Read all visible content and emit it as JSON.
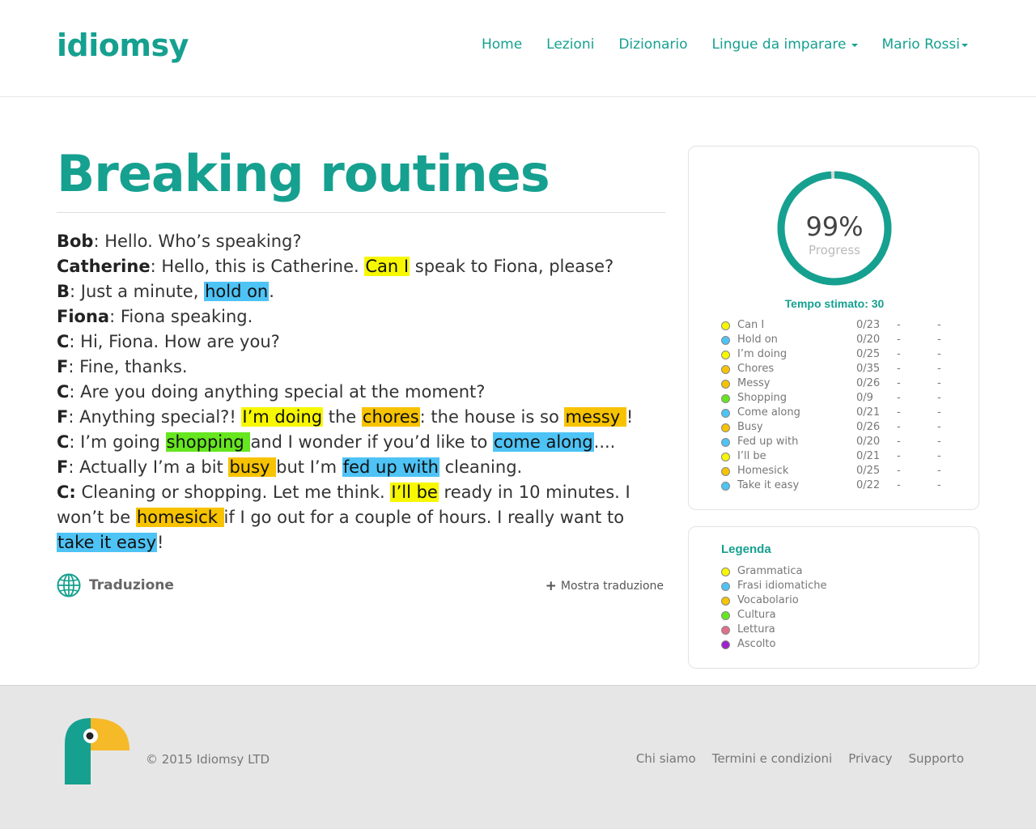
{
  "brand": {
    "logo_text": "idiomsy",
    "accent_color": "#16a090"
  },
  "nav": {
    "home": "Home",
    "lezioni": "Lezioni",
    "dizionario": "Dizionario",
    "lingue": "Lingue da imparare",
    "user": "Mario Rossi"
  },
  "lesson": {
    "title": "Breaking routines",
    "lines": [
      {
        "speaker": "Bob",
        "parts": [
          {
            "t": ": Hello. Who’s speaking?"
          }
        ]
      },
      {
        "speaker": "Catherine",
        "parts": [
          {
            "t": ": Hello, this is Catherine. "
          },
          {
            "t": "Can I",
            "hl": "yellow"
          },
          {
            "t": " speak to Fiona, please?"
          }
        ]
      },
      {
        "speaker": "B",
        "parts": [
          {
            "t": ": Just a minute, "
          },
          {
            "t": "hold on",
            "hl": "blue"
          },
          {
            "t": "."
          }
        ]
      },
      {
        "speaker": "Fiona",
        "parts": [
          {
            "t": ": Fiona speaking."
          }
        ]
      },
      {
        "speaker": "C",
        "parts": [
          {
            "t": ": Hi, Fiona. How are you?"
          }
        ]
      },
      {
        "speaker": "F",
        "parts": [
          {
            "t": ": Fine, thanks."
          }
        ]
      },
      {
        "speaker": "C",
        "parts": [
          {
            "t": ": Are you doing anything special at the moment?"
          }
        ]
      },
      {
        "speaker": "F",
        "parts": [
          {
            "t": ": Anything special?! "
          },
          {
            "t": "I’m doing",
            "hl": "yellow"
          },
          {
            "t": " the "
          },
          {
            "t": "chores",
            "hl": "orange"
          },
          {
            "t": ": the house is so "
          },
          {
            "t": "messy ",
            "hl": "orange"
          },
          {
            "t": "!"
          }
        ]
      },
      {
        "speaker": "C",
        "parts": [
          {
            "t": ": I’m going "
          },
          {
            "t": "shopping ",
            "hl": "green"
          },
          {
            "t": "and I wonder if you’d like to "
          },
          {
            "t": "come along",
            "hl": "blue"
          },
          {
            "t": "...."
          }
        ]
      },
      {
        "speaker": "F",
        "parts": [
          {
            "t": ": Actually I’m a bit "
          },
          {
            "t": "busy ",
            "hl": "orange"
          },
          {
            "t": "but I’m "
          },
          {
            "t": "fed up with",
            "hl": "blue"
          },
          {
            "t": " cleaning."
          }
        ]
      },
      {
        "speaker": "C:",
        "parts": [
          {
            "t": " Cleaning or shopping. Let me think. "
          },
          {
            "t": "I’ll be",
            "hl": "yellow"
          },
          {
            "t": " ready in 10 minutes. I won’t be "
          },
          {
            "t": "homesick ",
            "hl": "orange"
          },
          {
            "t": "if I go out for a couple of hours. I really want to "
          },
          {
            "t": "take it easy",
            "hl": "blue"
          },
          {
            "t": "!"
          }
        ]
      }
    ],
    "translation_label": "Traduzione",
    "show_translation": "Mostra traduzione"
  },
  "progress": {
    "percent_text": "99%",
    "percent_value": 0.99,
    "label": "Progress",
    "tempo": "Tempo stimato: 30",
    "items": [
      {
        "name": "Can I",
        "score": "0/23",
        "d1": "-",
        "d2": "-",
        "color": "#f7f700"
      },
      {
        "name": "Hold on",
        "score": "0/20",
        "d1": "-",
        "d2": "-",
        "color": "#4ec3f5"
      },
      {
        "name": "I’m doing",
        "score": "0/25",
        "d1": "-",
        "d2": "-",
        "color": "#f7f700"
      },
      {
        "name": "Chores",
        "score": "0/35",
        "d1": "-",
        "d2": "-",
        "color": "#f7c300"
      },
      {
        "name": "Messy",
        "score": "0/26",
        "d1": "-",
        "d2": "-",
        "color": "#f7c300"
      },
      {
        "name": "Shopping",
        "score": "0/9",
        "d1": "-",
        "d2": "-",
        "color": "#66e61f"
      },
      {
        "name": "Come along",
        "score": "0/21",
        "d1": "-",
        "d2": "-",
        "color": "#4ec3f5"
      },
      {
        "name": "Busy",
        "score": "0/26",
        "d1": "-",
        "d2": "-",
        "color": "#f7c300"
      },
      {
        "name": "Fed up with",
        "score": "0/20",
        "d1": "-",
        "d2": "-",
        "color": "#4ec3f5"
      },
      {
        "name": "I’ll be",
        "score": "0/21",
        "d1": "-",
        "d2": "-",
        "color": "#f7f700"
      },
      {
        "name": "Homesick",
        "score": "0/25",
        "d1": "-",
        "d2": "-",
        "color": "#f7c300"
      },
      {
        "name": "Take it easy",
        "score": "0/22",
        "d1": "-",
        "d2": "-",
        "color": "#4ec3f5"
      }
    ]
  },
  "legend": {
    "title": "Legenda",
    "items": [
      {
        "name": "Grammatica",
        "color": "#f7f700"
      },
      {
        "name": "Frasi idiomatiche",
        "color": "#4ec3f5"
      },
      {
        "name": "Vocabolario",
        "color": "#f7c300"
      },
      {
        "name": "Cultura",
        "color": "#66e61f"
      },
      {
        "name": "Lettura",
        "color": "#e0708a"
      },
      {
        "name": "Ascolto",
        "color": "#a020d0"
      }
    ]
  },
  "footer": {
    "copyright": "© 2015 Idiomsy LTD",
    "links": [
      "Chi siamo",
      "Termini e condizioni",
      "Privacy",
      "Supporto"
    ]
  },
  "highlight_colors": {
    "yellow": "#f7f700",
    "blue": "#4ec3f5",
    "orange": "#f7c300",
    "green": "#66e61f"
  }
}
